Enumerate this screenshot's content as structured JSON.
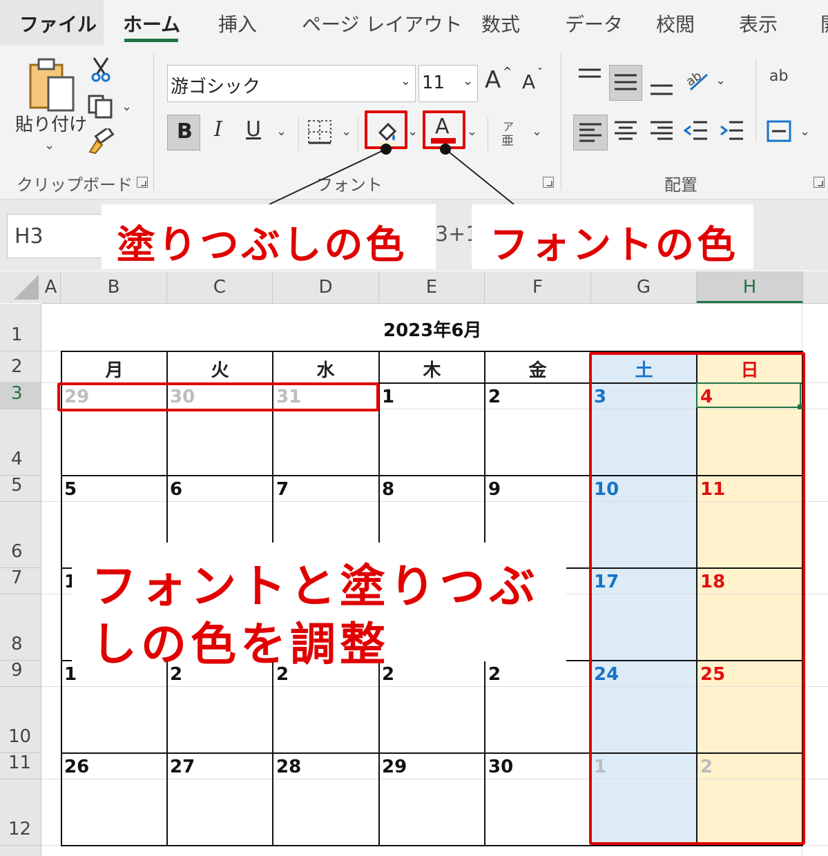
{
  "tabs": {
    "file": "ファイル",
    "home": "ホーム",
    "insert": "挿入",
    "page_layout": "ページ レイアウト",
    "formulas": "数式",
    "data": "データ",
    "review": "校閲",
    "view": "表示",
    "cut_off": "開"
  },
  "ribbon": {
    "clipboard": {
      "paste_label": "貼り付け",
      "group_label": "クリップボード"
    },
    "font": {
      "font_name": "游ゴシック",
      "font_size": "11",
      "grow": "A",
      "shrink": "A",
      "bold": "B",
      "italic": "I",
      "underline": "U",
      "font_color_glyph": "A",
      "phonetic_top": "ア",
      "phonetic_bottom": "亜",
      "group_label": "フォント"
    },
    "alignment": {
      "group_label": "配置",
      "wrap_glyph": "ab"
    }
  },
  "formula_bar": {
    "name_box": "H3",
    "formula_partial": "3+1"
  },
  "columns": [
    "A",
    "B",
    "C",
    "D",
    "E",
    "F",
    "G",
    "H"
  ],
  "rows": [
    "1",
    "2",
    "3",
    "4",
    "5",
    "6",
    "7",
    "8",
    "9",
    "10",
    "11",
    "12"
  ],
  "calendar": {
    "title": "2023年6月",
    "weekdays": [
      "月",
      "火",
      "水",
      "木",
      "金",
      "土",
      "日"
    ],
    "weeks": [
      [
        "29",
        "30",
        "31",
        "1",
        "2",
        "3",
        "4"
      ],
      [
        "5",
        "6",
        "7",
        "8",
        "9",
        "10",
        "11"
      ],
      [
        "1",
        "",
        "",
        "",
        "",
        "17",
        "18"
      ],
      [
        "1",
        "2",
        "2",
        "2",
        "2",
        "24",
        "25"
      ],
      [
        "26",
        "27",
        "28",
        "29",
        "30",
        "1",
        "2"
      ]
    ],
    "colors": {
      "saturday_text": "#1874c8",
      "sunday_text": "#e01010",
      "other_month_text": "#bdbdbd",
      "saturday_fill": "#ddebf7",
      "sunday_fill": "#fff2cc"
    }
  },
  "annotations": {
    "fill_color": "塗りつぶしの色",
    "font_color": "フォントの色",
    "main_line1": "フォントと塗りつぶ",
    "main_line2": "しの色を調整",
    "accent_color": "#e00000"
  }
}
